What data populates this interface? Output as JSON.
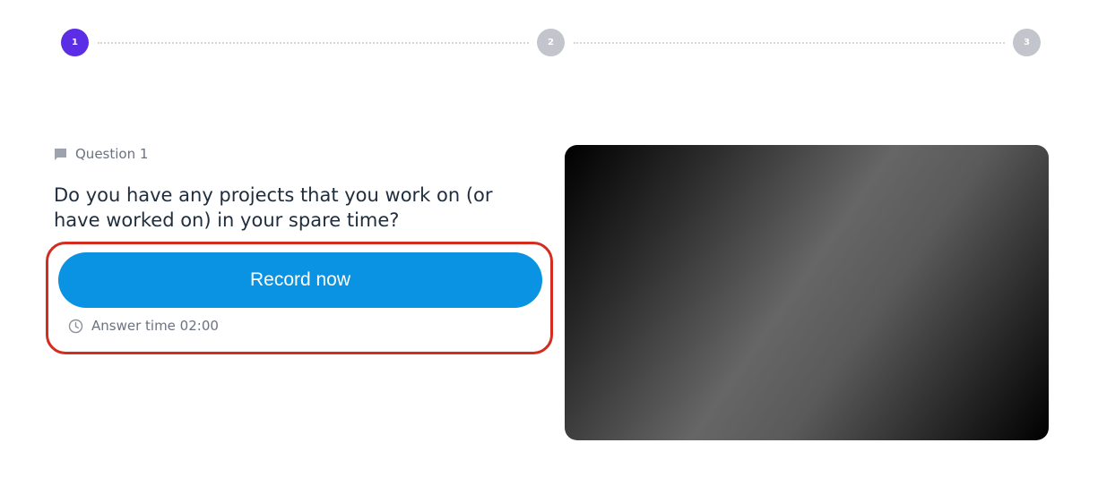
{
  "stepper": {
    "steps": [
      {
        "number": "1",
        "state": "active",
        "color": "#5b2ee6"
      },
      {
        "number": "2",
        "state": "inactive",
        "color": "#c2c5cb"
      },
      {
        "number": "3",
        "state": "inactive",
        "color": "#c2c5cb"
      }
    ]
  },
  "question": {
    "label": "Question 1",
    "label_icon": "chat-bubble-icon",
    "text": "Do you have any projects that you work on (or have worked on) in your spare time?"
  },
  "record": {
    "button_label": "Record now",
    "button_color": "#0a93e2",
    "highlight_color": "#d42c1f",
    "answer_time_label": "Answer time 02:00",
    "answer_time_icon": "clock-icon"
  },
  "video": {
    "state": "camera-preview"
  }
}
